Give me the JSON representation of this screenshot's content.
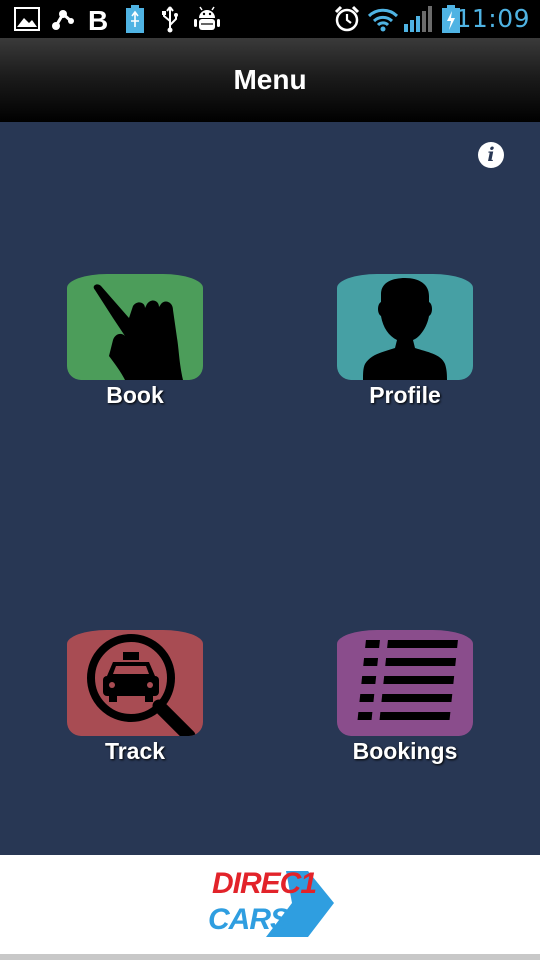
{
  "status_bar": {
    "time": "11:09",
    "left_icons": [
      "gallery-icon",
      "share-icon",
      "bold-b-icon",
      "usb-battery-icon",
      "usb-icon",
      "android-debug-icon"
    ],
    "right_icons": [
      "alarm-icon",
      "wifi-icon",
      "signal-icon",
      "battery-charging-icon"
    ],
    "time_color": "#4fb3e3"
  },
  "title_bar": {
    "title": "Menu"
  },
  "main": {
    "background": "#283754",
    "info_button": "i",
    "tiles": [
      {
        "label": "Book",
        "icon": "hand-pointing-icon",
        "color": "#4c9d5a"
      },
      {
        "label": "Profile",
        "icon": "person-silhouette-icon",
        "color": "#46a0a4"
      },
      {
        "label": "Track",
        "icon": "taxi-magnifier-icon",
        "color": "#a84c53"
      },
      {
        "label": "Bookings",
        "icon": "list-icon",
        "color": "#8a4d8c"
      }
    ]
  },
  "footer": {
    "logo_line1": "DIREC1",
    "logo_line2": "CARS",
    "logo_colors": {
      "red": "#e2232a",
      "blue": "#2f9ee0"
    }
  }
}
